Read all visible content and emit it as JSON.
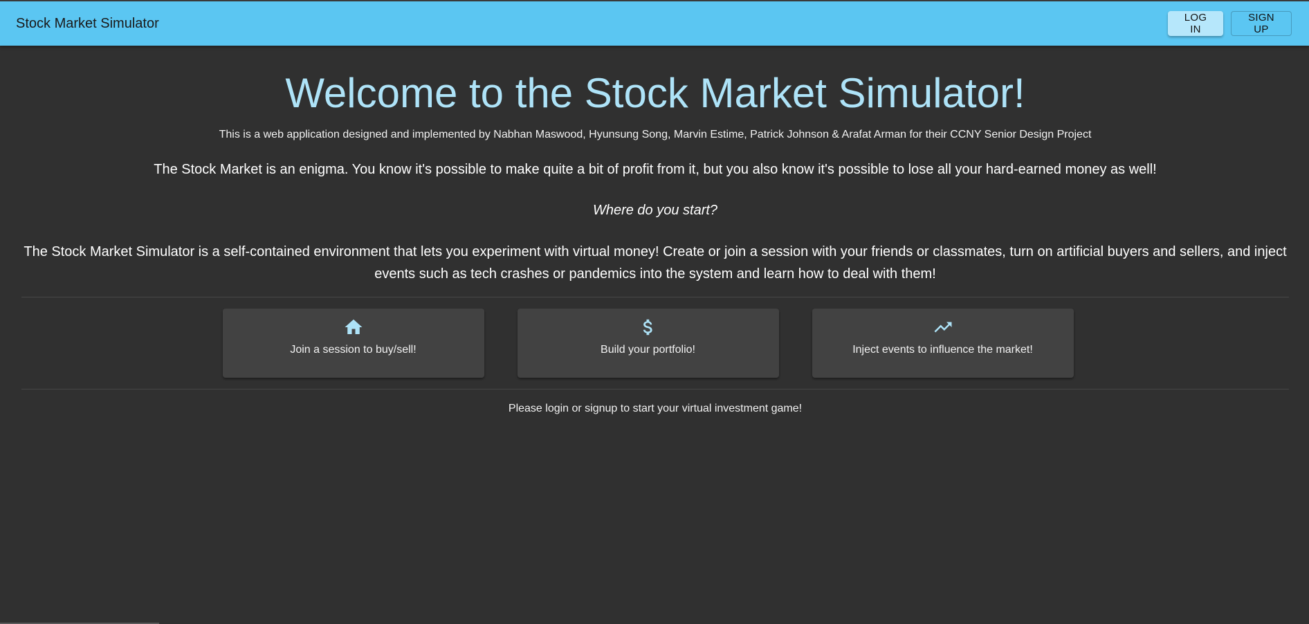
{
  "appbar": {
    "title": "Stock Market Simulator",
    "login_label": "LOG IN",
    "signup_label": "SIGN UP",
    "color": "#5bc6f2"
  },
  "main": {
    "welcome": "Welcome to the Stock Market Simulator!",
    "credits": "This is a web application designed and implemented by Nabhan Maswood, Hyunsung Song, Marvin Estime, Patrick Johnson & Arafat Arman for their CCNY Senior Design Project",
    "lead": "The Stock Market is an enigma. You know it's possible to make quite a bit of profit from it, but you also know it's possible to lose all your hard-earned money as well!",
    "question": "Where do you start?",
    "description": "The Stock Market Simulator is a self-contained environment that lets you experiment with virtual money! Create or join a session with your friends or classmates, turn on artificial buyers and sellers, and inject events such as tech crashes or pandemics into the system and learn how to deal with them!",
    "cta": "Please login or signup to start your virtual investment game!"
  },
  "features": [
    {
      "icon": "home-icon",
      "label": "Join a session to buy/sell!"
    },
    {
      "icon": "dollar-icon",
      "label": "Build your portfolio!"
    },
    {
      "icon": "trending-up-icon",
      "label": "Inject events to influence the market!"
    }
  ],
  "colors": {
    "background": "#303030",
    "card": "#424242",
    "accent": "#aee3f8"
  }
}
